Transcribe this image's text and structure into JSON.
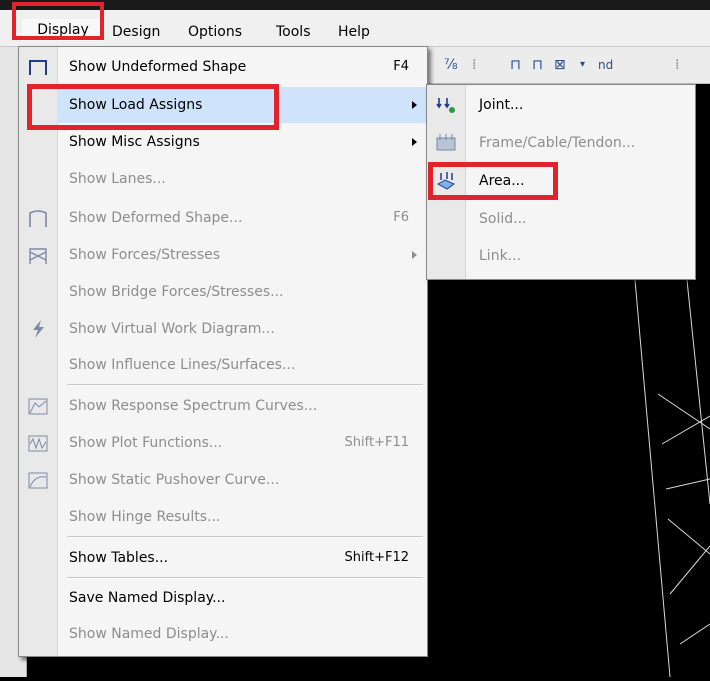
{
  "menubar": {
    "items": [
      {
        "id": "display",
        "label": "Display"
      },
      {
        "id": "design",
        "label": "Design"
      },
      {
        "id": "options",
        "label": "Options"
      },
      {
        "id": "tools",
        "label": "Tools"
      },
      {
        "id": "help",
        "label": "Help"
      }
    ]
  },
  "toolbar": {
    "nd_label": "nd"
  },
  "display_menu": {
    "items": [
      {
        "label": "Show Undeformed Shape",
        "shortcut": "F4",
        "enabled": true,
        "icon": "undeformed-shape-icon"
      },
      {
        "label": "Show Load Assigns",
        "shortcut": "",
        "enabled": true,
        "submenu": true
      },
      {
        "label": "Show Misc Assigns",
        "shortcut": "",
        "enabled": true,
        "submenu": true
      },
      {
        "label": "Show Lanes...",
        "shortcut": "",
        "enabled": false
      },
      {
        "label": "Show  Deformed Shape...",
        "shortcut": "F6",
        "enabled": false,
        "icon": "deformed-shape-icon"
      },
      {
        "label": "Show Forces/Stresses",
        "shortcut": "",
        "enabled": false,
        "submenu": true,
        "icon": "forces-stresses-icon"
      },
      {
        "label": "Show Bridge Forces/Stresses...",
        "shortcut": "",
        "enabled": false
      },
      {
        "label": "Show Virtual Work Diagram...",
        "shortcut": "",
        "enabled": false,
        "icon": "virtual-work-icon"
      },
      {
        "label": "Show Influence Lines/Surfaces...",
        "shortcut": "",
        "enabled": false
      },
      {
        "label": "Show Response Spectrum Curves...",
        "shortcut": "",
        "enabled": false,
        "icon": "response-spectrum-icon"
      },
      {
        "label": "Show Plot Functions...",
        "shortcut": "Shift+F11",
        "enabled": false,
        "icon": "plot-functions-icon"
      },
      {
        "label": "Show Static Pushover Curve...",
        "shortcut": "",
        "enabled": false,
        "icon": "pushover-curve-icon"
      },
      {
        "label": "Show Hinge Results...",
        "shortcut": "",
        "enabled": false
      },
      {
        "label": "Show Tables...",
        "shortcut": "Shift+F12",
        "enabled": true
      },
      {
        "label": "Save Named Display...",
        "shortcut": "",
        "enabled": true
      },
      {
        "label": "Show Named Display...",
        "shortcut": "",
        "enabled": false
      }
    ]
  },
  "load_assigns_submenu": {
    "items": [
      {
        "label": "Joint...",
        "enabled": true,
        "icon": "joint-load-icon"
      },
      {
        "label": "Frame/Cable/Tendon...",
        "enabled": false,
        "icon": "frame-load-icon"
      },
      {
        "label": "Area...",
        "enabled": true,
        "icon": "area-load-icon"
      },
      {
        "label": "Solid...",
        "enabled": false
      },
      {
        "label": "Link...",
        "enabled": false
      }
    ]
  },
  "colors": {
    "highlight_border": "#e1232d",
    "menu_bg": "#f5f5f5",
    "disabled_text": "#8d8d8d",
    "canvas_bg": "#000000"
  }
}
